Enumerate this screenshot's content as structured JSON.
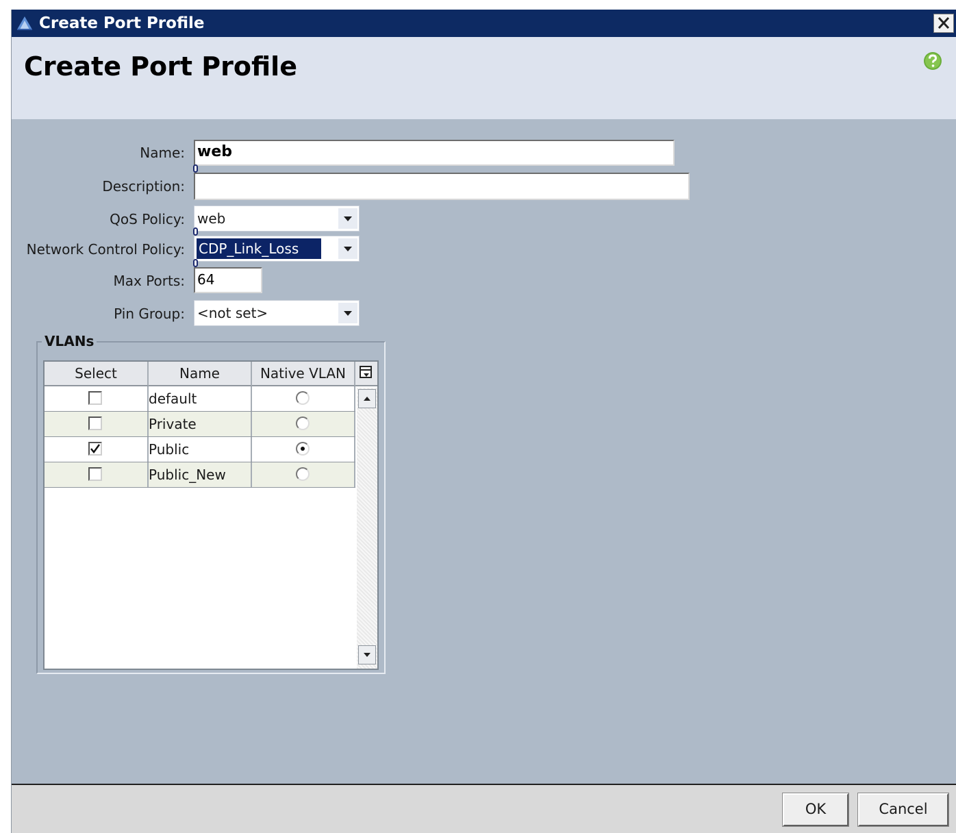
{
  "window": {
    "title": "Create Port Profile",
    "close_glyph": "✕"
  },
  "header": {
    "title": "Create Port Profile",
    "help_icon": "help-icon"
  },
  "form": {
    "name": {
      "label": "Name:",
      "value": "web"
    },
    "description": {
      "label": "Description:",
      "value": ""
    },
    "qos_policy": {
      "label": "QoS Policy:",
      "value": "web"
    },
    "network_control_policy": {
      "label": "Network Control Policy:",
      "value": "CDP_Link_Loss"
    },
    "max_ports": {
      "label": "Max Ports:",
      "value": "64"
    },
    "pin_group": {
      "label": "Pin Group:",
      "value": "<not set>"
    }
  },
  "vlans": {
    "title": "VLANs",
    "columns": [
      "Select",
      "Name",
      "Native VLAN"
    ],
    "rows": [
      {
        "name": "default",
        "selected": false,
        "native": false
      },
      {
        "name": "Private",
        "selected": false,
        "native": false
      },
      {
        "name": "Public",
        "selected": true,
        "native": true
      },
      {
        "name": "Public_New",
        "selected": false,
        "native": false
      }
    ]
  },
  "footer": {
    "ok_label": "OK",
    "cancel_label": "Cancel"
  },
  "colors": {
    "titlebar": "#0d2a63",
    "body": "#aebac8",
    "header": "#dde3ee",
    "selection": "#0c2466"
  }
}
